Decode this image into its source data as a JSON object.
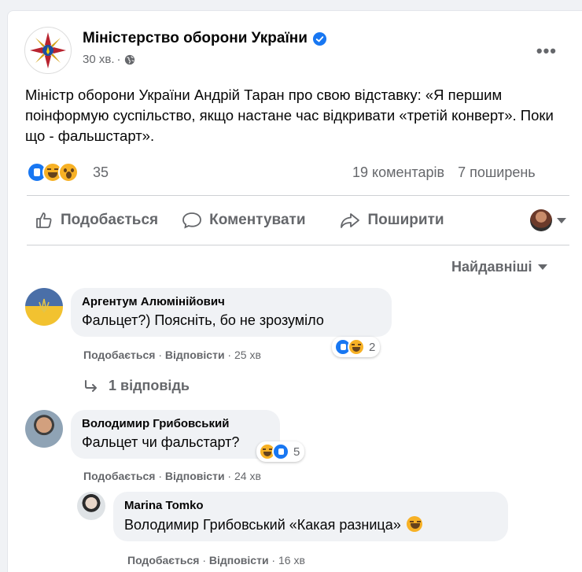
{
  "post": {
    "page_name": "Міністерство оборони України",
    "time": "30 хв.",
    "dot": "·",
    "text": "Міністр оборони України Андрій Таран про свою відставку: «Я першим поінформую  суспільство, якщо настане час відкривати «третій конверт». Поки що - фальшстарт».",
    "reaction_count": "35",
    "comments_count": "19 коментарів",
    "shares_count": "7 поширень",
    "reactions": [
      "like-icon",
      "haha-icon",
      "wow-icon"
    ]
  },
  "actions": {
    "like": "Подобається",
    "comment": "Коментувати",
    "share": "Поширити"
  },
  "sort": {
    "label": "Найдавніші"
  },
  "comments": [
    {
      "name": "Аргентум Алюмінійович",
      "text": "Фальцет?) Поясніть, бо не зрозуміло",
      "reaction_count": "2",
      "like": "Подобається",
      "reply": "Відповісти",
      "time": "25 хв",
      "replies_link": "1 відповідь"
    },
    {
      "name": "Володимир Грибовський",
      "text": "Фальцет чи фальстарт?",
      "reaction_count": "5",
      "like": "Подобається",
      "reply": "Відповісти",
      "time": "24 хв"
    },
    {
      "name": "Marina Tomko",
      "mention": "Володимир Грибовський",
      "text": " «Какая разница» ",
      "like": "Подобається",
      "reply": "Відповісти",
      "time": "16 хв"
    }
  ],
  "colors": {
    "accent": "#1877f2",
    "secondary_text": "#65676b",
    "bubble": "#f0f2f5"
  }
}
